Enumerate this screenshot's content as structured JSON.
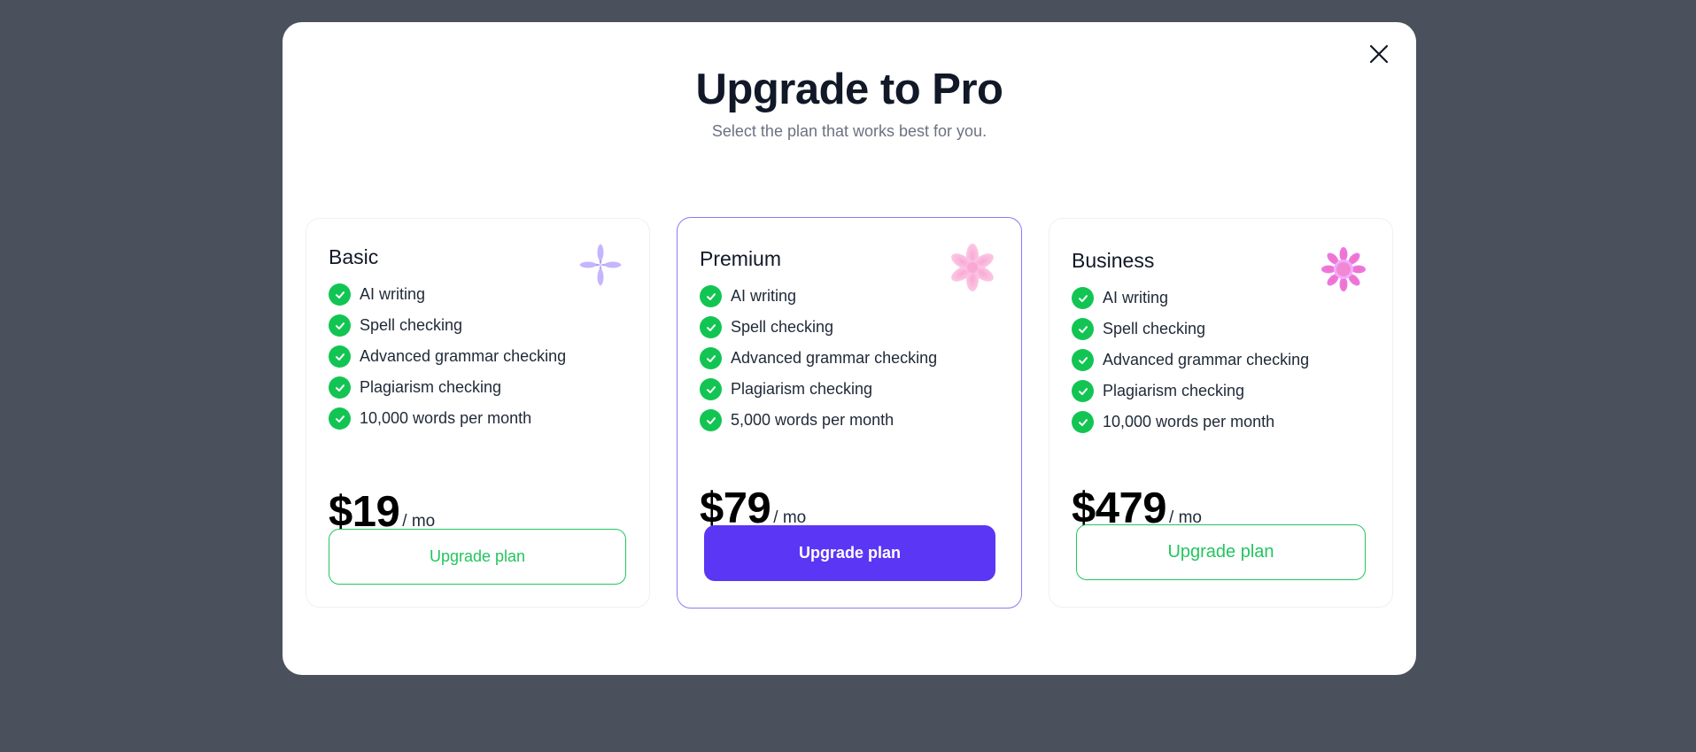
{
  "modal": {
    "title": "Upgrade to Pro",
    "subtitle": "Select the plan that works best for you.",
    "close_icon": "close-icon"
  },
  "plans": [
    {
      "name": "Basic",
      "icon": "sparkle-star-icon",
      "features": [
        "AI writing",
        "Spell checking",
        "Advanced grammar checking",
        "Plagiarism checking",
        "10,000 words per month"
      ],
      "price": "$19",
      "period": "/ mo",
      "button_label": "Upgrade plan",
      "button_style": "outline"
    },
    {
      "name": "Premium",
      "icon": "pink-flower-icon",
      "features": [
        "AI writing",
        "Spell checking",
        "Advanced grammar checking",
        "Plagiarism checking",
        "5,000 words per month"
      ],
      "price": "$79",
      "period": "/ mo",
      "button_label": "Upgrade plan",
      "button_style": "solid",
      "featured": true
    },
    {
      "name": "Business",
      "icon": "sun-flower-icon",
      "features": [
        "AI writing",
        "Spell checking",
        "Advanced grammar checking",
        "Plagiarism checking",
        "10,000 words per month"
      ],
      "price": "$479",
      "period": "/ mo",
      "button_label": "Upgrade plan",
      "button_style": "outline"
    }
  ],
  "colors": {
    "backdrop": "#4b515c",
    "accent_purple": "#5b36f5",
    "featured_border": "#8b7bf4",
    "check_green": "#12c553",
    "outline_green": "#22c55e"
  }
}
